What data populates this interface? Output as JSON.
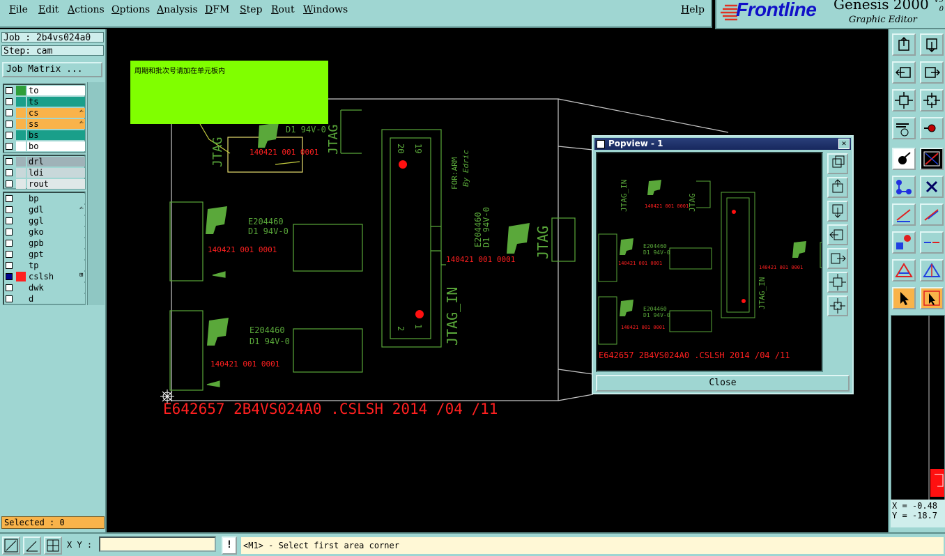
{
  "menu": {
    "file": "File",
    "edit": "Edit",
    "actions": "Actions",
    "options": "Options",
    "analysis": "Analysis",
    "dfm": "DFM",
    "step": "Step",
    "rout": "Rout",
    "windows": "Windows",
    "help": "Help"
  },
  "brand": {
    "logo": "Frontline",
    "product": "Genesis 2000",
    "subtitle": "Graphic Editor",
    "version_line1": "V9",
    "version_line2": "0"
  },
  "job": {
    "job_label": "Job : 2b4vs024a0",
    "step_label": "Step: cam",
    "matrix_button": "Job Matrix ..."
  },
  "layers": {
    "group1": [
      {
        "name": "to",
        "color": "#2f9e3a",
        "bg": "#ffffff",
        "edit": ""
      },
      {
        "name": "ts",
        "color": "#1a9f8a",
        "bg": "#1a9f8a",
        "edit": ""
      },
      {
        "name": "cs",
        "color": "#f9b34a",
        "bg": "#f9b34a",
        "edit": "✍"
      },
      {
        "name": "ss",
        "color": "#f9b34a",
        "bg": "#f9b34a",
        "edit": "✍"
      },
      {
        "name": "bs",
        "color": "#1a9f8a",
        "bg": "#1a9f8a",
        "edit": ""
      },
      {
        "name": "bo",
        "color": "#ffffff",
        "bg": "#ffffff",
        "edit": ""
      }
    ],
    "group2": [
      {
        "name": "drl",
        "color": "#9fb2b8",
        "bg": "#9fb2b8",
        "edit": ""
      },
      {
        "name": "ldi",
        "color": "#c8d8da",
        "bg": "#c8d8da",
        "edit": ""
      },
      {
        "name": "rout",
        "color": "#e0e8e8",
        "bg": "#e0e8e8",
        "edit": ""
      }
    ],
    "group3": [
      {
        "name": "bp",
        "color": "#9fd6d2",
        "bg": "#9fd6d2",
        "edit": ""
      },
      {
        "name": "gdl",
        "color": "#9fd6d2",
        "bg": "#9fd6d2",
        "edit": "✍"
      },
      {
        "name": "ggl",
        "color": "#9fd6d2",
        "bg": "#9fd6d2",
        "edit": ""
      },
      {
        "name": "gko",
        "color": "#9fd6d2",
        "bg": "#9fd6d2",
        "edit": ""
      },
      {
        "name": "gpb",
        "color": "#9fd6d2",
        "bg": "#9fd6d2",
        "edit": ""
      },
      {
        "name": "gpt",
        "color": "#9fd6d2",
        "bg": "#9fd6d2",
        "edit": ""
      },
      {
        "name": "tp",
        "color": "#9fd6d2",
        "bg": "#9fd6d2",
        "edit": ""
      },
      {
        "name": "cslsh",
        "color": "#ff2020",
        "bg": "#9fd6d2",
        "edit": "⊞",
        "active": true
      },
      {
        "name": "dwk",
        "color": "#9fd6d2",
        "bg": "#9fd6d2",
        "edit": ""
      },
      {
        "name": "d",
        "color": "#9fd6d2",
        "bg": "#9fd6d2",
        "edit": ""
      }
    ]
  },
  "selected": "Selected : 0",
  "coords": {
    "x": "X = -0.48",
    "y": "Y = -18.7"
  },
  "bottom": {
    "xy_label": "X Y :",
    "xy_value": "",
    "excl": "!",
    "status": "<M1> - Select first area corner"
  },
  "canvas": {
    "note": "周期和批次号请加在单元板内",
    "board_text": "E642657 2B4VS024A0 .CSLSH 2014 /04 /11",
    "ul_code": "E204460",
    "rating": "D1 94V-0",
    "date_code": "140421 001 0001",
    "jtag": "JTAG",
    "jtag_in": "JTAG_IN",
    "for_arm": "FOR:ARM",
    "by_edric": "By Edric",
    "pin20": "20",
    "pin19": "19",
    "pin1": "1",
    "pin2": "2"
  },
  "popview": {
    "title": "Popview - 1",
    "close_x": "✕",
    "close_button": "Close",
    "board_text": "E642657 2B4VS024A0 .CSLSH 2014 /04 /11",
    "ul_code": "E204460",
    "rating": "D1 94V-0",
    "date_code": "140421 001 0001",
    "jtag_in": "JTAG_IN",
    "jtag": "JTAG"
  },
  "colors": {
    "panel": "#9fd6d2",
    "trace": "#5aa83a",
    "silk": "#ff2020",
    "note": "#80ff00",
    "selected": "#f9b34a"
  }
}
